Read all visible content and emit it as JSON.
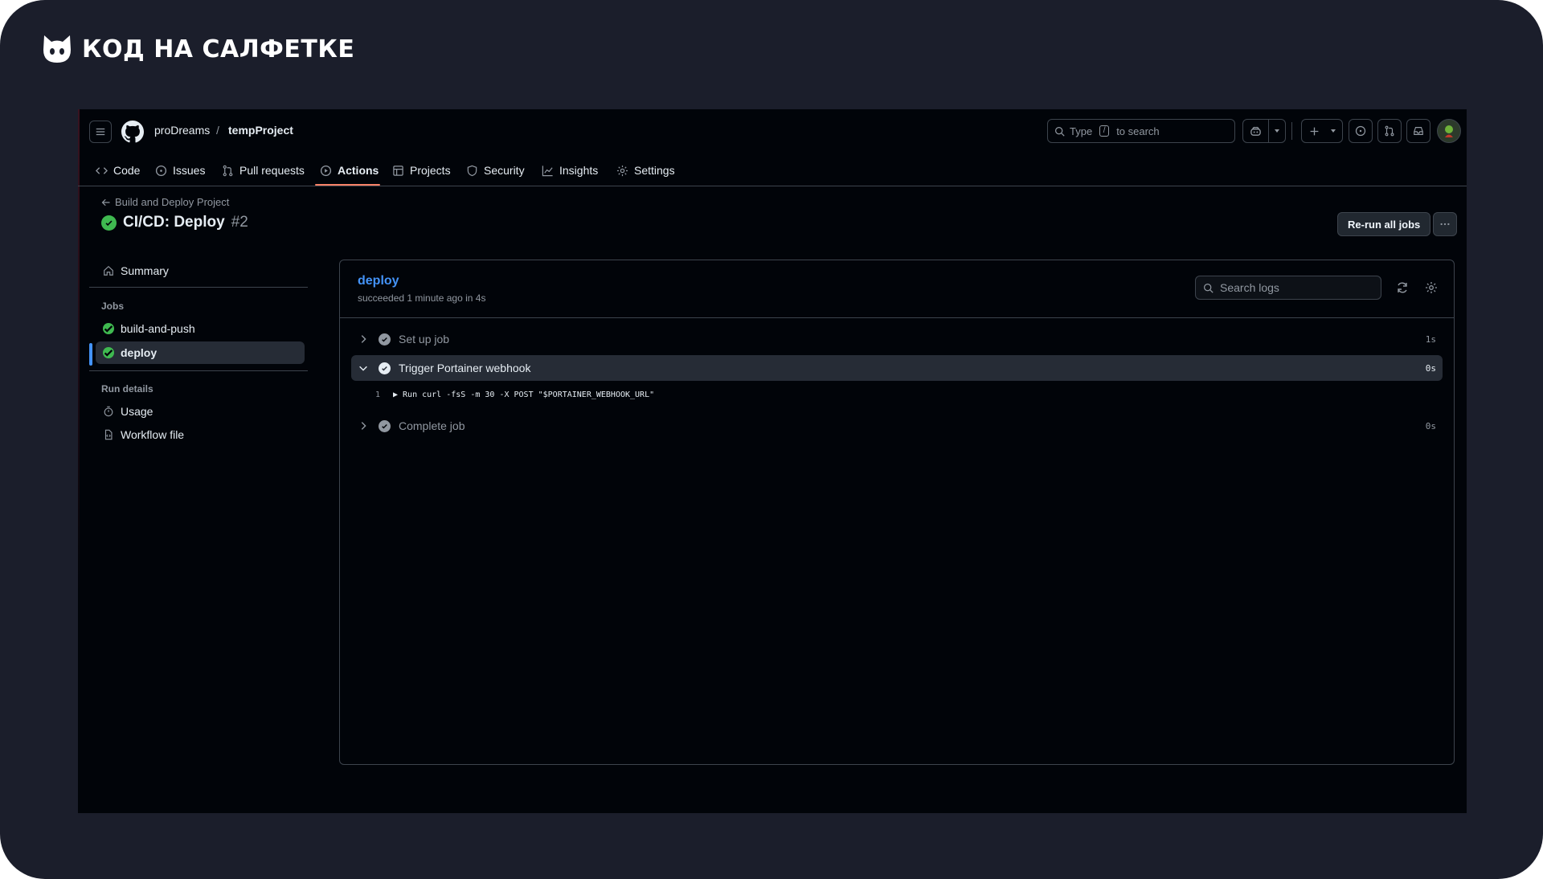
{
  "brand": {
    "text": "КОД НА САЛФЕТКЕ"
  },
  "header": {
    "owner": "proDreams",
    "separator": "/",
    "repo": "tempProject",
    "search": {
      "prefix": "Type",
      "key": "/",
      "suffix": "to search"
    }
  },
  "tabs": [
    {
      "label": "Code",
      "icon": "code-icon"
    },
    {
      "label": "Issues",
      "icon": "issue-opened-icon"
    },
    {
      "label": "Pull requests",
      "icon": "git-pull-request-icon"
    },
    {
      "label": "Actions",
      "icon": "play-icon",
      "active": true
    },
    {
      "label": "Projects",
      "icon": "table-icon"
    },
    {
      "label": "Security",
      "icon": "shield-icon"
    },
    {
      "label": "Insights",
      "icon": "graph-icon"
    },
    {
      "label": "Settings",
      "icon": "gear-icon"
    }
  ],
  "run": {
    "back_label": "Build and Deploy Project",
    "title": "CI/CD: Deploy",
    "number": "#2",
    "rerun_label": "Re-run all jobs"
  },
  "sidebar": {
    "summary": "Summary",
    "jobs_heading": "Jobs",
    "jobs": [
      "build-and-push",
      "deploy"
    ],
    "run_details_heading": "Run details",
    "details": [
      "Usage",
      "Workflow file"
    ]
  },
  "job": {
    "name": "deploy",
    "status": "succeeded 1 minute ago in 4s",
    "search_placeholder": "Search logs",
    "steps": [
      {
        "name": "Set up job",
        "duration": "1s"
      },
      {
        "name": "Trigger Portainer webhook",
        "duration": "0s"
      },
      {
        "name": "Complete job",
        "duration": "0s"
      }
    ],
    "log": {
      "line": "1",
      "text": "▶ Run curl -fsS -m 30 -X POST \"$PORTAINER_WEBHOOK_URL\""
    }
  },
  "colors": {
    "accent_blue": "#4493f8",
    "success_green": "#3fb950",
    "tab_underline": "#f78166",
    "frame_bg": "#1b1e2b"
  }
}
